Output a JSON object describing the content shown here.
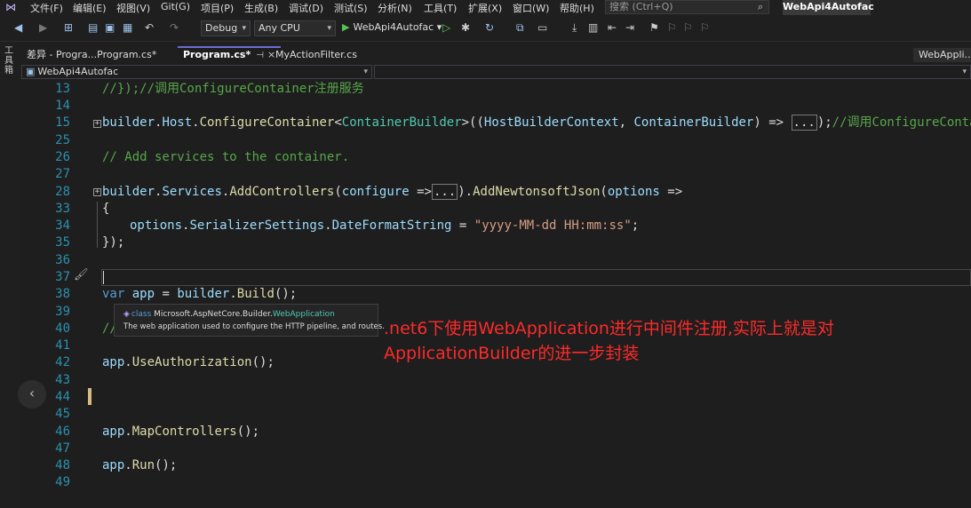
{
  "menubar": {
    "items": [
      "文件(F)",
      "编辑(E)",
      "视图(V)",
      "Git(G)",
      "项目(P)",
      "生成(B)",
      "调试(D)",
      "测试(S)",
      "分析(N)",
      "工具(T)",
      "扩展(X)",
      "窗口(W)",
      "帮助(H)"
    ],
    "search_placeholder": "搜索 (Ctrl+Q)",
    "solution_name": "WebApi4Autofac"
  },
  "toolbar": {
    "configuration": "Debug",
    "platform": "Any CPU",
    "run_target": "WebApi4Autofac"
  },
  "left_strip": {
    "toolbox_label": "工具箱"
  },
  "tabs": [
    {
      "label": "差异 - Progra...Program.cs*",
      "active": false
    },
    {
      "label": "Program.cs*",
      "active": true
    },
    {
      "label": "MyActionFilter.cs",
      "active": false
    },
    {
      "label": "WebAppli...",
      "active": false
    }
  ],
  "navbar": {
    "project": "WebApi4Autofac",
    "member": ""
  },
  "code_lines": [
    {
      "num": "13",
      "text": "//});//调用ConfigureContainer注册服务"
    },
    {
      "num": "14",
      "text": ""
    },
    {
      "num": "15",
      "text": "builder.Host.ConfigureContainer<ContainerBuilder>((HostBuilderContext, ContainerBuilder) => ...);//调用ConfigureContainer注册"
    },
    {
      "num": "25",
      "text": ""
    },
    {
      "num": "26",
      "text": "// Add services to the container."
    },
    {
      "num": "27",
      "text": ""
    },
    {
      "num": "28",
      "text": "builder.Services.AddControllers(configure => ...).AddNewtonsoftJson(options =>"
    },
    {
      "num": "33",
      "text": "{"
    },
    {
      "num": "34",
      "text": "options.SerializerSettings.DateFormatString = \"yyyy-MM-dd HH:mm:ss\";"
    },
    {
      "num": "35",
      "text": "});"
    },
    {
      "num": "36",
      "text": ""
    },
    {
      "num": "37",
      "text": ""
    },
    {
      "num": "38",
      "text": "var app = builder.Build();"
    },
    {
      "num": "39",
      "text": ""
    },
    {
      "num": "40",
      "text": "//"
    },
    {
      "num": "41",
      "text": ""
    },
    {
      "num": "42",
      "text": "app.UseAuthorization();"
    },
    {
      "num": "43",
      "text": ""
    },
    {
      "num": "44",
      "text": ""
    },
    {
      "num": "45",
      "text": ""
    },
    {
      "num": "46",
      "text": "app.MapControllers();"
    },
    {
      "num": "47",
      "text": ""
    },
    {
      "num": "48",
      "text": "app.Run();"
    },
    {
      "num": "49",
      "text": ""
    }
  ],
  "code_tokens": {
    "builder": "builder",
    "host": "Host",
    "configure_container": "ConfigureContainer",
    "container_builder": "ContainerBuilder",
    "host_builder_context": "HostBuilderContext",
    "arrow": "=>",
    "ellipsis": "...",
    "comment15": "//调用ConfigureContainer注册",
    "services": "Services",
    "add_controllers": "AddControllers",
    "configure": "configure",
    "add_newtonsoft": "AddNewtonsoftJson",
    "options": "options",
    "serializer_settings": "SerializerSettings",
    "date_format": "DateFormatString",
    "date_str": "\"yyyy-MM-dd HH:mm:ss\"",
    "var": "var",
    "app": "app",
    "build": "Build",
    "use_authorization": "UseAuthorization",
    "map_controllers": "MapControllers",
    "run": "Run"
  },
  "tooltip": {
    "kind": "class",
    "namespace": "Microsoft.AspNetCore.Builder.",
    "type_name": "WebApplication",
    "description": "The web application used to configure the HTTP pipeline, and routes."
  },
  "annotation": {
    "line1": ".net6下使用WebApplication进行中间件注册,实际上就是对",
    "line2": "ApplicationBuilder的进一步封装"
  },
  "colors": {
    "comment": "#57a64a",
    "keyword": "#569cd6",
    "type": "#4ec9b0",
    "string": "#d69d85",
    "annotation": "#ff2a2a"
  }
}
